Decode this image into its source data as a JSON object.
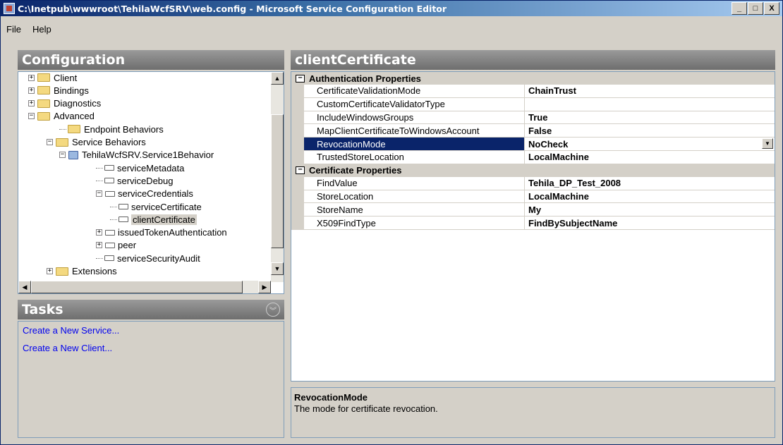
{
  "window": {
    "title": "C:\\Inetpub\\wwwroot\\TehilaWcfSRV\\web.config - Microsoft Service Configuration Editor",
    "minimize": "_",
    "maximize": "□",
    "close": "X"
  },
  "menu": {
    "file": "File",
    "help": "Help"
  },
  "configuration": {
    "header": "Configuration",
    "tree": [
      {
        "label": "Client",
        "expander": "+"
      },
      {
        "label": "Bindings",
        "expander": "+"
      },
      {
        "label": "Diagnostics",
        "expander": "+"
      },
      {
        "label": "Advanced",
        "expander": "−"
      },
      {
        "label": "Endpoint Behaviors",
        "expander": ""
      },
      {
        "label": "Service Behaviors",
        "expander": "−"
      },
      {
        "label": "TehilaWcfSRV.Service1Behavior",
        "expander": "−"
      },
      {
        "label": "serviceMetadata",
        "expander": ""
      },
      {
        "label": "serviceDebug",
        "expander": ""
      },
      {
        "label": "serviceCredentials",
        "expander": "−"
      },
      {
        "label": "serviceCertificate",
        "expander": ""
      },
      {
        "label": "clientCertificate",
        "expander": "",
        "selected": true
      },
      {
        "label": "issuedTokenAuthentication",
        "expander": "+"
      },
      {
        "label": "peer",
        "expander": "+"
      },
      {
        "label": "serviceSecurityAudit",
        "expander": ""
      },
      {
        "label": "Extensions",
        "expander": "+"
      }
    ]
  },
  "tasks": {
    "header": "Tasks",
    "links": [
      "Create a New Service...",
      "Create a New Client..."
    ]
  },
  "editor": {
    "header": "clientCertificate",
    "categories": [
      {
        "title": "Authentication Properties",
        "properties": [
          {
            "name": "CertificateValidationMode",
            "value": "ChainTrust"
          },
          {
            "name": "CustomCertificateValidatorType",
            "value": ""
          },
          {
            "name": "IncludeWindowsGroups",
            "value": "True"
          },
          {
            "name": "MapClientCertificateToWindowsAccount",
            "value": "False"
          },
          {
            "name": "RevocationMode",
            "value": "NoCheck",
            "selected": true
          },
          {
            "name": "TrustedStoreLocation",
            "value": "LocalMachine"
          }
        ]
      },
      {
        "title": "Certificate Properties",
        "properties": [
          {
            "name": "FindValue",
            "value": "Tehila_DP_Test_2008"
          },
          {
            "name": "StoreLocation",
            "value": "LocalMachine"
          },
          {
            "name": "StoreName",
            "value": "My"
          },
          {
            "name": "X509FindType",
            "value": "FindBySubjectName"
          }
        ]
      }
    ],
    "description": {
      "title": "RevocationMode",
      "text": "The mode for certificate revocation."
    }
  }
}
